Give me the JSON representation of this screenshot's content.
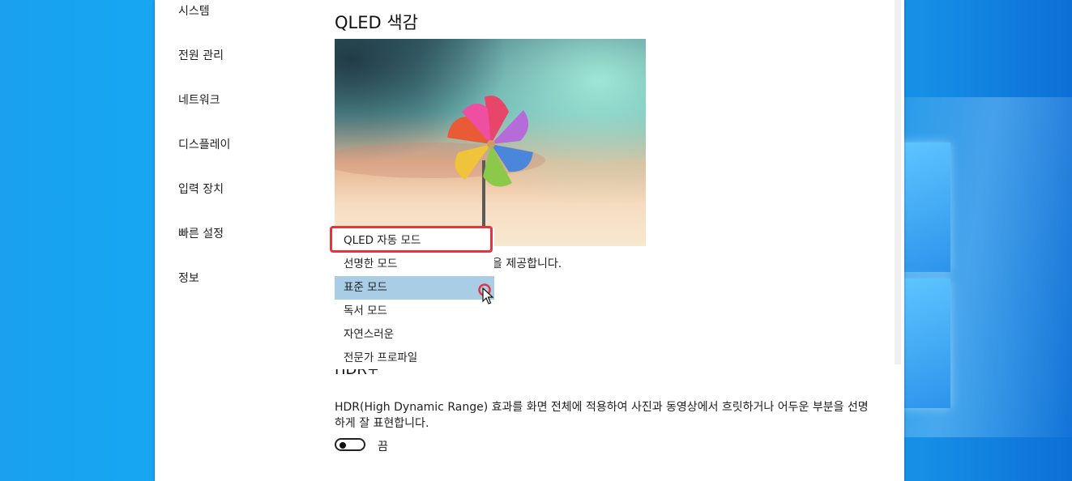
{
  "sidebar": {
    "items": [
      {
        "label": "시스템"
      },
      {
        "label": "전원 관리"
      },
      {
        "label": "네트워크"
      },
      {
        "label": "디스플레이"
      },
      {
        "label": "입력 장치"
      },
      {
        "label": "빠른 설정"
      },
      {
        "label": "정보"
      }
    ]
  },
  "qled": {
    "title": "QLED 색감",
    "description_fragment": "을 제공합니다."
  },
  "dropdown": {
    "options": [
      {
        "label": "QLED 자동 모드",
        "highlighted": true
      },
      {
        "label": "선명한 모드"
      },
      {
        "label": "표준 모드",
        "selected": true
      },
      {
        "label": "독서 모드"
      },
      {
        "label": "자연스러운"
      },
      {
        "label": "전문가 프로파일"
      }
    ]
  },
  "hdr": {
    "title": "HDR+",
    "description": "HDR(High Dynamic Range) 효과를 화면 전체에 적용하여 사진과 동영상에서 흐릿하거나 어두운 부분을 선명하게 잘 표현합니다.",
    "toggle_state": "끔"
  },
  "colors": {
    "highlight_border": "#e8333d",
    "selected_item_bg": "#a9cde5",
    "desktop_blue": "#1590e6"
  }
}
